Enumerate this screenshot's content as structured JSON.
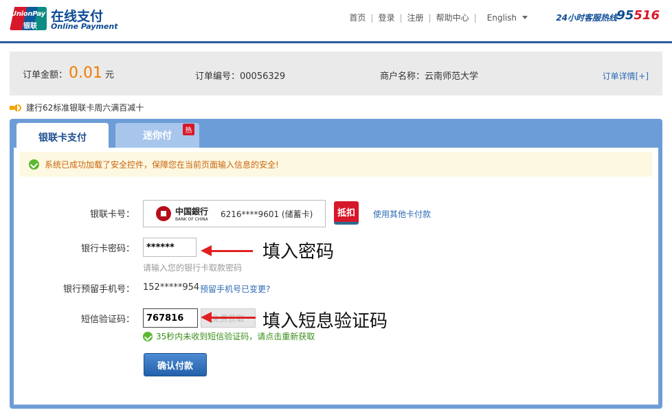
{
  "header": {
    "logo_line1": "UnionPay",
    "logo_line2": "银联",
    "brand_cn": "在线支付",
    "brand_en": "Online Payment",
    "nav": [
      "首页",
      "登录",
      "注册",
      "帮助中心"
    ],
    "language": "English",
    "hotline_label": "24小时客服热线",
    "hotline_a": "95",
    "hotline_b": "516",
    "accent": "#0b4a94"
  },
  "order": {
    "amount_label": "订单金额：",
    "amount_value": "0.01",
    "amount_unit": "元",
    "number_label": "订单编号：00056329",
    "merchant_label": "商户名称：云南师范大学",
    "detail_link": "订单详情[+]",
    "amount_color": "#f07c00"
  },
  "notice": {
    "text": "建行62标准银联卡周六满百减十",
    "icon": "speaker-icon"
  },
  "tabs": [
    {
      "label": "银联卡支付",
      "active": true
    },
    {
      "label": "迷你付",
      "active": false,
      "badge": "热"
    }
  ],
  "security": {
    "text": "系统已成功加载了安全控件，保障您在当前页面输入信息的安全!",
    "icon": "check-icon"
  },
  "form": {
    "card_label": "银联卡号：",
    "bank_name_cn": "中国銀行",
    "bank_name_en": "BANK OF CHINA",
    "card_number": "6216****9601 (储蓄卡)",
    "discount_label": "抵扣",
    "other_card": "使用其他卡付款",
    "password_label": "银行卡密码：",
    "password_value": "******",
    "password_hint": "请输入您的银行卡取款密码",
    "phone_label": "银行预留手机号：",
    "phone_value": "152*****954",
    "phone_change": "预留手机号已变更?",
    "sms_label": "短信验证码：",
    "sms_value": "767816",
    "sms_button": "免费获取",
    "sms_tip": "35秒内未收到短信验证码，请点击重新获取",
    "confirm": "确认付款"
  },
  "annotations": {
    "password": "填入密码",
    "sms": "填入短息验证码"
  }
}
